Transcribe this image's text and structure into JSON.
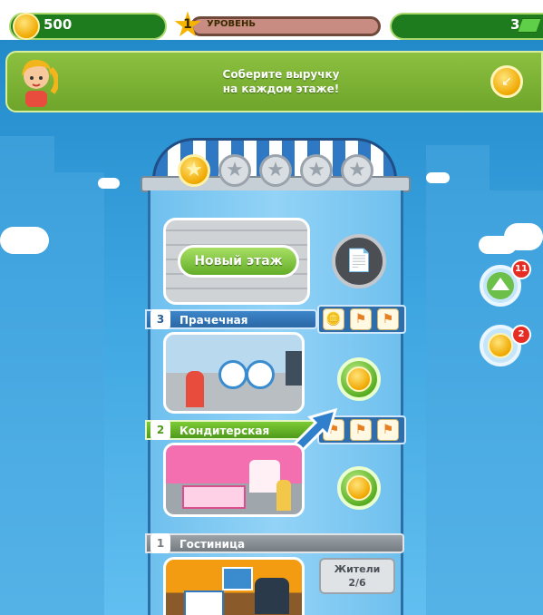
{
  "hud": {
    "coins": "500",
    "level_number": "1",
    "level_label": "УРОВЕНЬ",
    "level_progress": 0.0,
    "bux": "3"
  },
  "quest_banner": {
    "line1": "Соберите выручку",
    "line2": "на каждом этаже!"
  },
  "tower": {
    "stars_earned": 1,
    "stars_total": 5,
    "new_floor_label": "Новый этаж",
    "floors": [
      {
        "number": "3",
        "name": "Прачечная",
        "color": "blue"
      },
      {
        "number": "2",
        "name": "Кондитерская",
        "color": "green"
      },
      {
        "number": "1",
        "name": "Гостиница",
        "color": "gray"
      }
    ],
    "residents_label": "Жители",
    "residents_value": "2/6"
  },
  "side_buttons": [
    {
      "icon": "elevator-up-icon",
      "badge": "11"
    },
    {
      "icon": "coin-icon",
      "badge": "2"
    }
  ],
  "colors": {
    "sky": "#3aa3df",
    "hud_green": "#1e7c1e",
    "banner_green": "#7ab233",
    "badge_red": "#e62d24",
    "coin_gold": "#f0a800"
  }
}
